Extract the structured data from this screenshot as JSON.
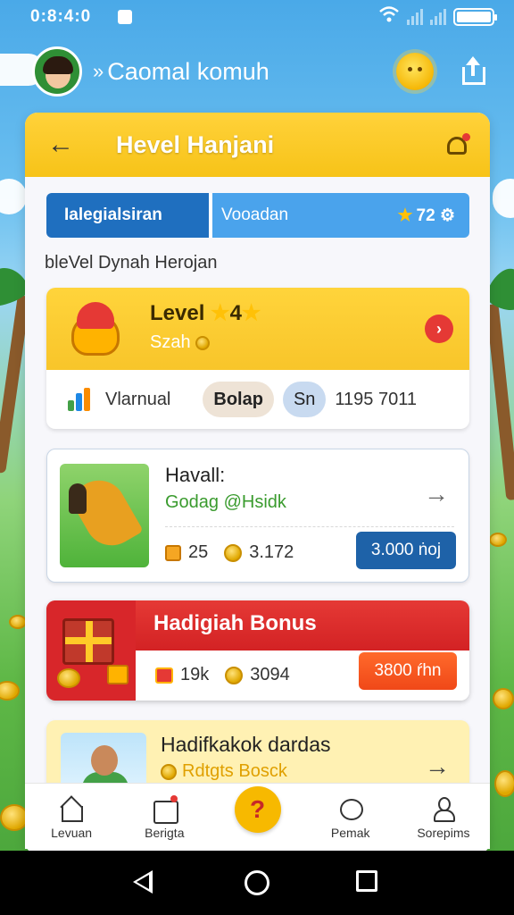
{
  "status_bar": {
    "time": "0:8:4:0"
  },
  "header": {
    "user_name": "Caomal komuh",
    "name_chevron": "»"
  },
  "card": {
    "title": "Hevel Hanjani",
    "back_glyph": "←"
  },
  "tabs": {
    "tab_a": "Ialegialsiran",
    "tab_b": "Vooadan",
    "tab_b_badge": "72 ⚙"
  },
  "section_title": "bleVel Dynah Herojan",
  "level_card": {
    "title": "Level",
    "level_number": "4",
    "subtitle": "Szah",
    "go_glyph": "›",
    "bottom_label": "Vlarnual",
    "pill_1": "Bolap",
    "pill_2": "Sn",
    "bottom_value": "1195 7011"
  },
  "reward_card": {
    "title": "Havall:",
    "subtitle": "Godag @Hsidk",
    "arrow_glyph": "→",
    "stat_1": "25",
    "stat_2": "3.172",
    "price": "3.000 ṅoj"
  },
  "bonus_card": {
    "title": "Hadigiah Bonus",
    "stat_1": "19k",
    "stat_2": "3094",
    "price": "3800 ŕhn"
  },
  "yellow_card": {
    "title": "Hadifkakok dardas",
    "subtitle": "Rdtgts Bosck",
    "arrow_glyph": "→"
  },
  "bottom_nav": {
    "items": [
      {
        "label": "Levuan",
        "icon": "home-icon"
      },
      {
        "label": "Berigta",
        "icon": "calendar-icon"
      },
      {
        "label": "?",
        "icon": "help-icon"
      },
      {
        "label": "Pemak",
        "icon": "chat-icon"
      },
      {
        "label": "Sorepims",
        "icon": "profile-icon"
      }
    ]
  },
  "colors": {
    "sky": "#4aa9e8",
    "header_yellow": "#ffd23a",
    "tab_dark_blue": "#1f6fbf",
    "tab_light_blue": "#4aa3ec",
    "bonus_red": "#e53935",
    "price_blue": "#1e62a8",
    "price_orange": "#f04818"
  }
}
